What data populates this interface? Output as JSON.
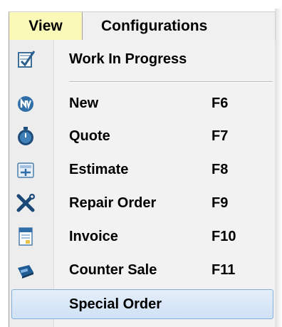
{
  "menubar": {
    "view_label": "View",
    "configurations_label": "Configurations"
  },
  "menu": {
    "work_in_progress": {
      "label": "Work In Progress",
      "icon": "clipboard-check-icon"
    },
    "items": [
      {
        "label": "New",
        "shortcut": "F6",
        "icon": "new-badge-icon"
      },
      {
        "label": "Quote",
        "shortcut": "F7",
        "icon": "stopwatch-icon"
      },
      {
        "label": "Estimate",
        "shortcut": "F8",
        "icon": "calculator-icon"
      },
      {
        "label": "Repair Order",
        "shortcut": "F9",
        "icon": "tools-icon"
      },
      {
        "label": "Invoice",
        "shortcut": "F10",
        "icon": "invoice-icon"
      },
      {
        "label": "Counter Sale",
        "shortcut": "F11",
        "icon": "cash-register-icon"
      },
      {
        "label": "Special Order",
        "shortcut": "",
        "icon": ""
      }
    ]
  },
  "colors": {
    "view_highlight": "#fbf9b8",
    "selected_item_border": "#86aed8",
    "selected_item_fill": "#d6e6f7",
    "menu_background": "#f2f2f2"
  }
}
